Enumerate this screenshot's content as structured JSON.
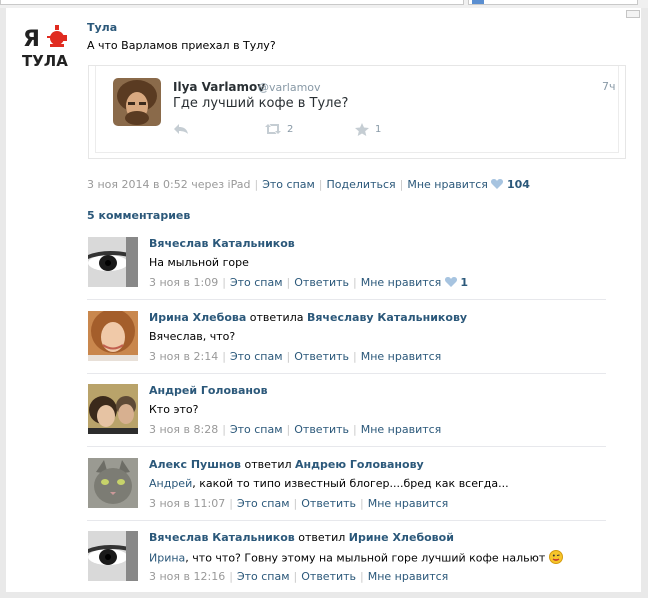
{
  "post": {
    "group_name": "Тула",
    "logo_letter": "Я",
    "logo_city": "ТУЛА",
    "text": "А что Варламов приехал в Тулу?",
    "date": "3 ноя 2014 в 0:52 через iPad",
    "spam": "Это спам",
    "share": "Поделиться",
    "like": "Мне нравится",
    "like_count": "104"
  },
  "tweet": {
    "name": "Ilya Varlamov",
    "handle": "@varlamov",
    "time": "7ч",
    "text": "Где лучший кофе в Туле?",
    "retweets": "2",
    "favorites": "1"
  },
  "comments_title": "5 комментариев",
  "comments": [
    {
      "author": "Вячеслав Катальников",
      "reply_word": "",
      "reply_to": "",
      "mention": "",
      "text": "На мыльной горе",
      "date": "3 ноя в 1:09",
      "spam": "Это спам",
      "reply": "Ответить",
      "like": "Мне нравится",
      "like_count": "1"
    },
    {
      "author": "Ирина Хлебова",
      "reply_word": "ответила",
      "reply_to": "Вячеславу Катальникову",
      "mention": "",
      "text": "Вячеслав, что?",
      "date": "3 ноя в 2:14",
      "spam": "Это спам",
      "reply": "Ответить",
      "like": "Мне нравится",
      "like_count": ""
    },
    {
      "author": "Андрей Голованов",
      "reply_word": "",
      "reply_to": "",
      "mention": "",
      "text": "Кто это?",
      "date": "3 ноя в 8:28",
      "spam": "Это спам",
      "reply": "Ответить",
      "like": "Мне нравится",
      "like_count": ""
    },
    {
      "author": "Алекс Пушнов",
      "reply_word": "ответил",
      "reply_to": "Андрею Голованову",
      "mention": "Андрей",
      "text": ", какой то типо известный блогер....бред как всегда...",
      "date": "3 ноя в 11:07",
      "spam": "Это спам",
      "reply": "Ответить",
      "like": "Мне нравится",
      "like_count": ""
    },
    {
      "author": "Вячеслав Катальников",
      "reply_word": "ответил",
      "reply_to": "Ирине Хлебовой",
      "mention": "Ирина",
      "text": ", что что? Говну этому на мыльной горе лучший кофе нальют",
      "date": "3 ноя в 12:16",
      "spam": "Это спам",
      "reply": "Ответить",
      "like": "Мне нравится",
      "like_count": ""
    }
  ],
  "colors": {
    "link": "#2b587a",
    "meta": "#999999",
    "logo_red": "#e02b20",
    "heart": "#a7c4e0"
  },
  "icons": [
    "samovar-logo-icon",
    "reply-icon",
    "retweet-icon",
    "favorite-star-icon",
    "heart-icon",
    "wink-emoji-icon"
  ]
}
